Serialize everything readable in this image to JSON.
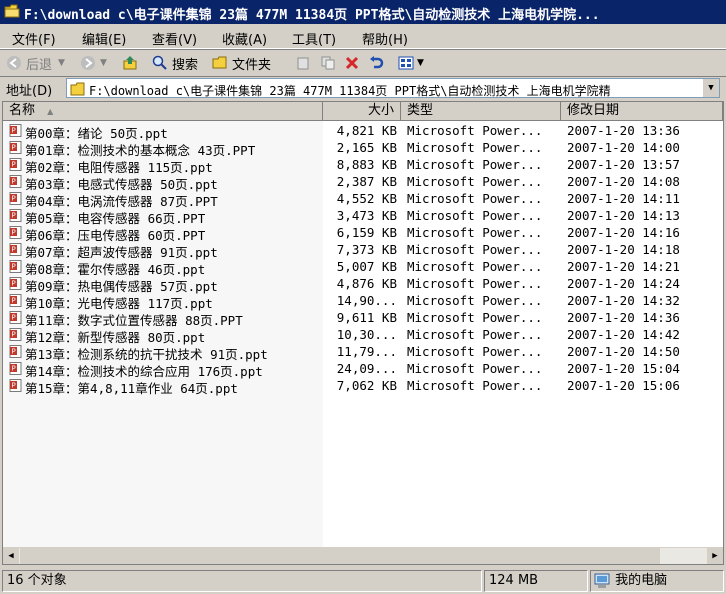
{
  "window": {
    "title": "F:\\download c\\电子课件集锦 23篇 477M 11384页 PPT格式\\自动检测技术 上海电机学院..."
  },
  "menu": [
    "文件(F)",
    "编辑(E)",
    "查看(V)",
    "收藏(A)",
    "工具(T)",
    "帮助(H)"
  ],
  "toolbar": {
    "back_label": "后退",
    "search_label": "搜索",
    "folders_label": "文件夹"
  },
  "address": {
    "label": "地址(D)",
    "value": "F:\\download c\\电子课件集锦 23篇 477M 11384页 PPT格式\\自动检测技术 上海电机学院精"
  },
  "columns": {
    "name": "名称",
    "size": "大小",
    "type": "类型",
    "modified": "修改日期"
  },
  "files": [
    {
      "name": "第00章：绪论 50页.ppt",
      "size": "4,821 KB",
      "type": "Microsoft Power...",
      "modified": "2007-1-20 13:36"
    },
    {
      "name": "第01章：检测技术的基本概念 43页.PPT",
      "size": "2,165 KB",
      "type": "Microsoft Power...",
      "modified": "2007-1-20 14:00"
    },
    {
      "name": "第02章：电阻传感器 115页.ppt",
      "size": "8,883 KB",
      "type": "Microsoft Power...",
      "modified": "2007-1-20 13:57"
    },
    {
      "name": "第03章：电感式传感器 50页.ppt",
      "size": "2,387 KB",
      "type": "Microsoft Power...",
      "modified": "2007-1-20 14:08"
    },
    {
      "name": "第04章：电涡流传感器 87页.PPT",
      "size": "4,552 KB",
      "type": "Microsoft Power...",
      "modified": "2007-1-20 14:11"
    },
    {
      "name": "第05章：电容传感器 66页.PPT",
      "size": "3,473 KB",
      "type": "Microsoft Power...",
      "modified": "2007-1-20 14:13"
    },
    {
      "name": "第06章：压电传感器 60页.PPT",
      "size": "6,159 KB",
      "type": "Microsoft Power...",
      "modified": "2007-1-20 14:16"
    },
    {
      "name": "第07章：超声波传感器 91页.ppt",
      "size": "7,373 KB",
      "type": "Microsoft Power...",
      "modified": "2007-1-20 14:18"
    },
    {
      "name": "第08章：霍尔传感器 46页.ppt",
      "size": "5,007 KB",
      "type": "Microsoft Power...",
      "modified": "2007-1-20 14:21"
    },
    {
      "name": "第09章：热电偶传感器 57页.ppt",
      "size": "4,876 KB",
      "type": "Microsoft Power...",
      "modified": "2007-1-20 14:24"
    },
    {
      "name": "第10章：光电传感器 117页.ppt",
      "size": "14,90...",
      "type": "Microsoft Power...",
      "modified": "2007-1-20 14:32"
    },
    {
      "name": "第11章：数字式位置传感器 88页.PPT",
      "size": "9,611 KB",
      "type": "Microsoft Power...",
      "modified": "2007-1-20 14:36"
    },
    {
      "name": "第12章：新型传感器 80页.ppt",
      "size": "10,30...",
      "type": "Microsoft Power...",
      "modified": "2007-1-20 14:42"
    },
    {
      "name": "第13章：检测系统的抗干扰技术 91页.ppt",
      "size": "11,79...",
      "type": "Microsoft Power...",
      "modified": "2007-1-20 14:50"
    },
    {
      "name": "第14章：检测技术的综合应用 176页.ppt",
      "size": "24,09...",
      "type": "Microsoft Power...",
      "modified": "2007-1-20 15:04"
    },
    {
      "name": "第15章：第4,8,11章作业 64页.ppt",
      "size": "7,062 KB",
      "type": "Microsoft Power...",
      "modified": "2007-1-20 15:06"
    }
  ],
  "status": {
    "objects": "16 个对象",
    "total_size": "124 MB",
    "location": "我的电脑"
  },
  "colors": {
    "titlebar": "#0a246a",
    "chrome": "#d4d0c8",
    "ppt_icon": "#c0392b"
  }
}
